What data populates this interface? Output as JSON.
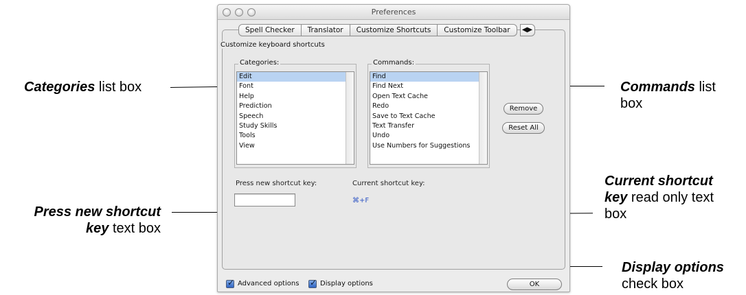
{
  "window": {
    "title": "Preferences",
    "tabs": [
      {
        "label": "Spell Checker"
      },
      {
        "label": "Translator"
      },
      {
        "label": "Customize Shortcuts",
        "selected": true
      },
      {
        "label": "Customize Toolbar"
      }
    ],
    "tab_overflow": "◀▶"
  },
  "shortcuts": {
    "group_label": "Customize keyboard shortcuts",
    "categories": {
      "label": "Categories:",
      "selected": "Edit",
      "items": [
        "Edit",
        "Font",
        "Help",
        "Prediction",
        "Speech",
        "Study Skills",
        "Tools",
        "View"
      ]
    },
    "commands": {
      "label": "Commands:",
      "selected": "Find",
      "items": [
        "Find",
        "Find Next",
        "Open Text Cache",
        "Redo",
        "Save to Text Cache",
        "Text Transfer",
        "Undo",
        "Use Numbers for Suggestions"
      ]
    },
    "remove_label": "Remove",
    "reset_all_label": "Reset All",
    "new_key_label": "Press new shortcut key:",
    "new_key_value": "",
    "current_key_label": "Current shortcut key:",
    "current_key_value": "⌘+F"
  },
  "footer": {
    "advanced_options_label": "Advanced options",
    "advanced_options_checked": true,
    "display_options_label": "Display options",
    "display_options_checked": true,
    "ok_label": "OK"
  },
  "annotations": {
    "categories": {
      "bold": "Categories",
      "rest": " list box"
    },
    "commands": {
      "bold": "Commands",
      "rest": " list",
      "line2": "box"
    },
    "press_new": {
      "bold1": "Press new shortcut",
      "bold2": "key",
      "rest": " text box"
    },
    "current_key": {
      "bold1": "Current shortcut",
      "bold2": "key",
      "rest": " read only text",
      "line3": "box"
    },
    "display_options": {
      "bold": "Display options",
      "line2": "check box"
    }
  }
}
